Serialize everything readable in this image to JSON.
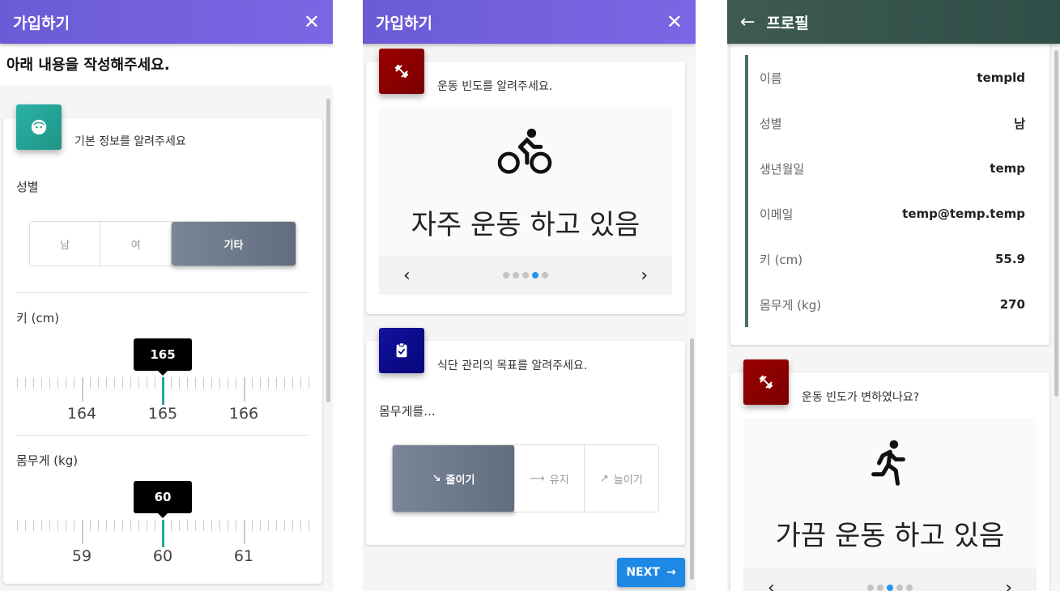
{
  "signup": {
    "title": "가입하기",
    "close_icon": "close-icon"
  },
  "step1": {
    "instruction": "아래 내용을 작성해주세요.",
    "card_title": "기본 정보를 알려주세요",
    "badge_icon": "face-icon",
    "badge_color": "#26a69a",
    "gender_label": "성별",
    "gender_options": [
      "남",
      "여",
      "기타"
    ],
    "gender_selected": "기타",
    "height_label": "키 (cm)",
    "height_value": "165",
    "height_ticks": [
      "164",
      "165",
      "166"
    ],
    "weight_label": "몸무게 (kg)",
    "weight_value": "60",
    "weight_ticks": [
      "59",
      "60",
      "61"
    ]
  },
  "step2": {
    "exercise_card_title": "운동 빈도를 알려주세요.",
    "exercise_badge_icon": "dumbbell-icon",
    "exercise_badge_color": "#8b0000",
    "exercise_icon": "bike-icon",
    "exercise_text": "자주 운동 하고 있음",
    "exercise_dots_active": 4,
    "exercise_dots_total": 5,
    "diet_card_title": "식단 관리의 목표를 알려주세요.",
    "diet_badge_icon": "clipboard-check-icon",
    "diet_badge_color": "#0a0a8c",
    "diet_prompt": "몸무게를...",
    "diet_options": [
      "줄이기",
      "유지",
      "늘이기"
    ],
    "diet_selected": "줄이기",
    "next_label": "NEXT",
    "accent": "#1e88e5"
  },
  "profile": {
    "title": "프로필",
    "back_icon": "arrow-left-icon",
    "header_color": "#3d5b52",
    "group1": [
      {
        "key": "이름",
        "value": "templd"
      },
      {
        "key": "성별",
        "value": "남"
      },
      {
        "key": "생년월일",
        "value": "temp"
      }
    ],
    "group2": [
      {
        "key": "이메일",
        "value": "temp@temp.temp"
      },
      {
        "key": "키 (cm)",
        "value": "55.9"
      },
      {
        "key": "몸무게 (kg)",
        "value": "270"
      }
    ],
    "exercise_card_title": "운동 빈도가 변하였나요?",
    "exercise_icon": "running-icon",
    "exercise_text": "가끔 운동 하고 있음",
    "exercise_dots_active": 3,
    "exercise_dots_total": 5
  }
}
